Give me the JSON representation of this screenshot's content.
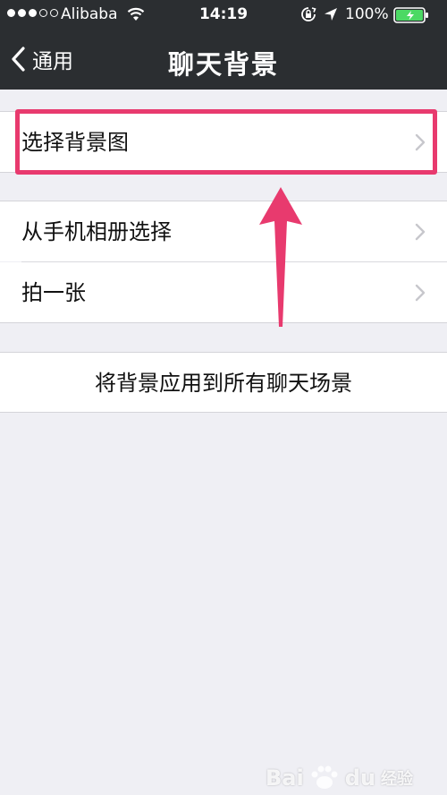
{
  "status_bar": {
    "carrier": "Alibaba",
    "time": "14:19",
    "battery_percent": "100%",
    "signal_bars_filled": 3,
    "signal_bars_total": 5,
    "battery_level": 1.0,
    "icons": [
      "signal-dots-icon",
      "wifi-icon",
      "rotation-lock-icon",
      "location-arrow-icon",
      "battery-icon"
    ]
  },
  "nav_bar": {
    "back_label": "通用",
    "title": "聊天背景"
  },
  "section1": {
    "items": [
      {
        "label": "选择背景图"
      }
    ]
  },
  "section2": {
    "items": [
      {
        "label": "从手机相册选择"
      },
      {
        "label": "拍一张"
      }
    ]
  },
  "section3": {
    "apply_all_label": "将背景应用到所有聊天场景"
  },
  "watermark": {
    "brand": "Bai",
    "brand_suffix": "du",
    "sub": "经验"
  },
  "colors": {
    "nav_background": "#2b2e31",
    "page_background": "#efeff4",
    "highlight_annotation": "#e83a6e",
    "battery_fill": "#4cd964"
  }
}
